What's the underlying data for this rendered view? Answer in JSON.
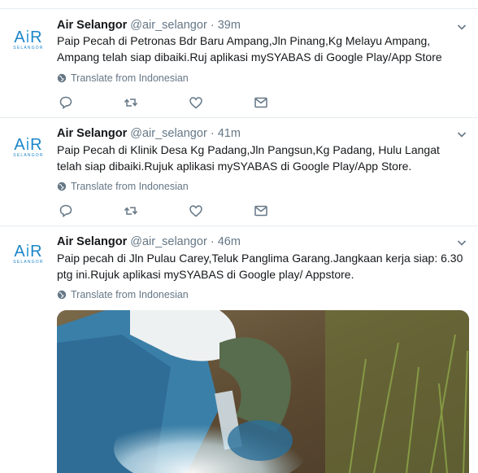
{
  "tweets": [
    {
      "name": "Air Selangor",
      "handle": "@air_selangor",
      "separator": "·",
      "time": "39m",
      "text_line1": "Paip Pecah di Petronas Bdr Baru Ampang,Jln Pinang,Kg Melayu Ampang,",
      "text_line2": "Ampang telah siap dibaiki.Ruj aplikasi mySYABAS di Google Play/App Store",
      "translate": "Translate from Indonesian"
    },
    {
      "name": "Air Selangor",
      "handle": "@air_selangor",
      "separator": "·",
      "time": "41m",
      "text_line1": "Paip Pecah di Klinik Desa Kg Padang,Jln Pangsun,Kg Padang, Hulu Langat",
      "text_line2": "telah siap dibaiki.Rujuk aplikasi mySYABAS di Google Play/App Store.",
      "translate": "Translate from Indonesian"
    },
    {
      "name": "Air Selangor",
      "handle": "@air_selangor",
      "separator": "·",
      "time": "46m",
      "text_line1": "Paip pecah di Jln Pulau Carey,Teluk Panglima Garang.Jangkaan kerja siap: 6.30",
      "text_line2": "ptg ini.Rujuk aplikasi mySYABAS di Google play/ Appstore.",
      "translate": "Translate from Indonesian"
    }
  ],
  "logo": {
    "main_left": "A",
    "main_mid": "i",
    "main_right": "R",
    "sub": "SELANGOR"
  },
  "colors": {
    "brand_blue": "#1c86c8",
    "muted": "#657786",
    "divider": "#e6ecf0"
  },
  "icons": [
    "reply-icon",
    "retweet-icon",
    "like-icon",
    "message-icon",
    "globe-icon",
    "chevron-down-icon"
  ]
}
